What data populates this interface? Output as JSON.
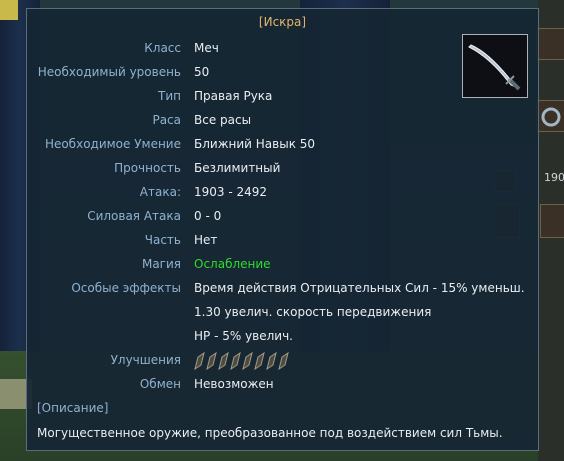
{
  "tooltip": {
    "title": "[Искра]",
    "item_icon": "sword-icon",
    "stats": [
      {
        "label": "Класс",
        "value": "Меч"
      },
      {
        "label": "Необходимый уровень",
        "value": "50"
      },
      {
        "label": "Тип",
        "value": "Правая Рука"
      },
      {
        "label": "Раса",
        "value": "Все расы"
      },
      {
        "label": "Необходимое Умение",
        "value": "Ближний Навык 50"
      },
      {
        "label": "Прочность",
        "value": "Безлимитный"
      },
      {
        "label": "Атака:",
        "value": "1903 - 2492"
      },
      {
        "label": "Силовая Атака",
        "value": "0 - 0"
      },
      {
        "label": "Часть",
        "value": "Нет"
      },
      {
        "label": "Магия",
        "value": "Ослабление"
      },
      {
        "label": "Особые эффекты",
        "value": "Время действия Отрицательных Сил - 15% уменьш."
      },
      {
        "label": "",
        "value": "1.30 увелич. скорость передвижения"
      },
      {
        "label": "",
        "value": "HP - 5% увелич."
      },
      {
        "label": "Улучшения",
        "value": ""
      },
      {
        "label": "Обмен",
        "value": "Невозможен"
      }
    ],
    "upgrade_slots": 8,
    "description_header": "[Описание]",
    "description": "Могущественное оружие, преобразованное под воздействием сил Тьмы."
  },
  "side_panel": {
    "number": "190"
  },
  "colors": {
    "title": "#e2b46a",
    "label": "#8fb2d0",
    "value": "#eaeef2",
    "magic": "#2fdc2a"
  }
}
